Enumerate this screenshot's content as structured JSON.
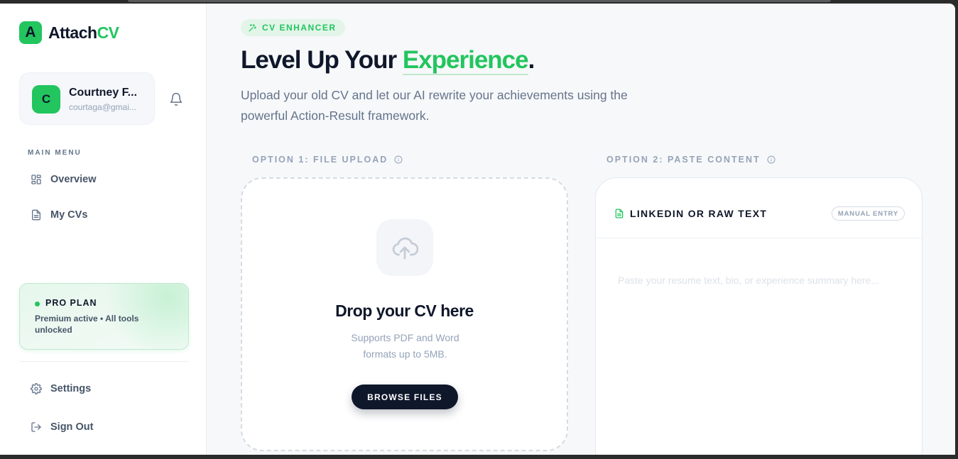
{
  "app": {
    "logo_mark": "A",
    "logo_text_main": "Attach",
    "logo_text_accent": "CV"
  },
  "profile": {
    "avatar_initial": "C",
    "name": "Courtney F...",
    "email": "courtaga@gmai..."
  },
  "sidebar": {
    "menu_heading": "MAIN MENU",
    "items": [
      {
        "label": "Overview",
        "icon": "grid-icon"
      },
      {
        "label": "My CVs",
        "icon": "document-icon"
      }
    ],
    "pro": {
      "title": "PRO PLAN",
      "description": "Premium active • All tools unlocked"
    },
    "settings_label": "Settings",
    "signout_label": "Sign Out"
  },
  "main": {
    "badge": "CV ENHANCER",
    "headline_part1": "Level Up Your ",
    "headline_highlight": "Experience",
    "headline_end": ".",
    "subtitle": "Upload your old CV and let our AI rewrite your achievements using the powerful Action-Result framework.",
    "option1_label": "OPTION 1: FILE UPLOAD",
    "option2_label": "OPTION 2: PASTE CONTENT",
    "upload": {
      "title": "Drop your CV here",
      "description": "Supports PDF and Word formats up to 5MB.",
      "button_label": "BROWSE FILES"
    },
    "paste": {
      "title": "LINKEDIN OR RAW TEXT",
      "tag": "MANUAL ENTRY",
      "placeholder": "Paste your resume text, bio, or experience summary here...",
      "value": ""
    }
  },
  "colors": {
    "accent": "#22c55e",
    "dark": "#0f172a",
    "muted": "#94a3b8"
  }
}
